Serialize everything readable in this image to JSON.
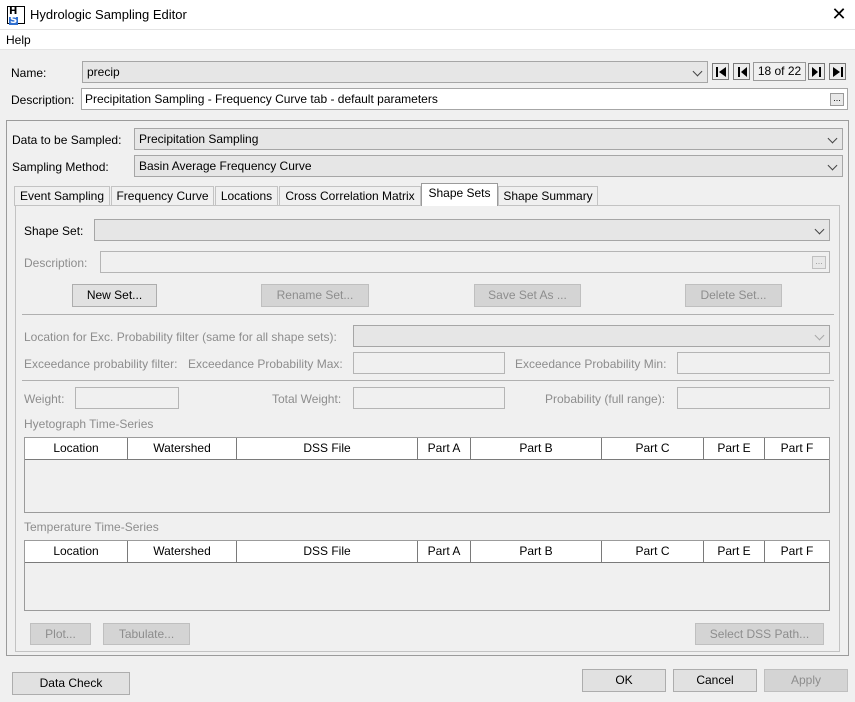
{
  "window": {
    "title": "Hydrologic Sampling Editor"
  },
  "menu": {
    "help": "Help"
  },
  "name_row": {
    "label": "Name:",
    "value": "precip",
    "counter": "18 of 22"
  },
  "description_row": {
    "label": "Description:",
    "value": "Precipitation Sampling - Frequency Curve tab - default parameters",
    "dots": "..."
  },
  "data_sampled": {
    "label": "Data to be Sampled:",
    "value": "Precipitation Sampling"
  },
  "sampling_method": {
    "label": "Sampling Method:",
    "value": "Basin Average Frequency Curve"
  },
  "tabs": [
    {
      "label": "Event Sampling"
    },
    {
      "label": "Frequency Curve"
    },
    {
      "label": "Locations"
    },
    {
      "label": "Cross Correlation Matrix"
    },
    {
      "label": "Shape Sets"
    },
    {
      "label": "Shape Summary"
    }
  ],
  "shape_sets": {
    "shape_set_label": "Shape Set:",
    "description_label": "Description:",
    "dots": "...",
    "buttons": {
      "new_set": "New Set...",
      "rename_set": "Rename Set...",
      "save_set_as": "Save Set As ...",
      "delete_set": "Delete Set..."
    },
    "location_filter_label": "Location for Exc. Probability filter (same for all shape sets):",
    "exceedance_filter_label": "Exceedance probability filter:",
    "exceedance_max_label": "Exceedance Probability Max:",
    "exceedance_min_label": "Exceedance Probability Min:",
    "weight_label": "Weight:",
    "total_weight_label": "Total Weight:",
    "probability_label": "Probability (full range):",
    "hyetograph_title": "Hyetograph Time-Series",
    "temperature_title": "Temperature Time-Series",
    "columns": [
      "Location",
      "Watershed",
      "DSS File",
      "Part A",
      "Part B",
      "Part C",
      "Part E",
      "Part F"
    ],
    "plot_button": "Plot...",
    "tabulate_button": "Tabulate...",
    "select_dss_button": "Select DSS Path..."
  },
  "footer": {
    "data_check": "Data Check",
    "ok": "OK",
    "cancel": "Cancel",
    "apply": "Apply"
  }
}
